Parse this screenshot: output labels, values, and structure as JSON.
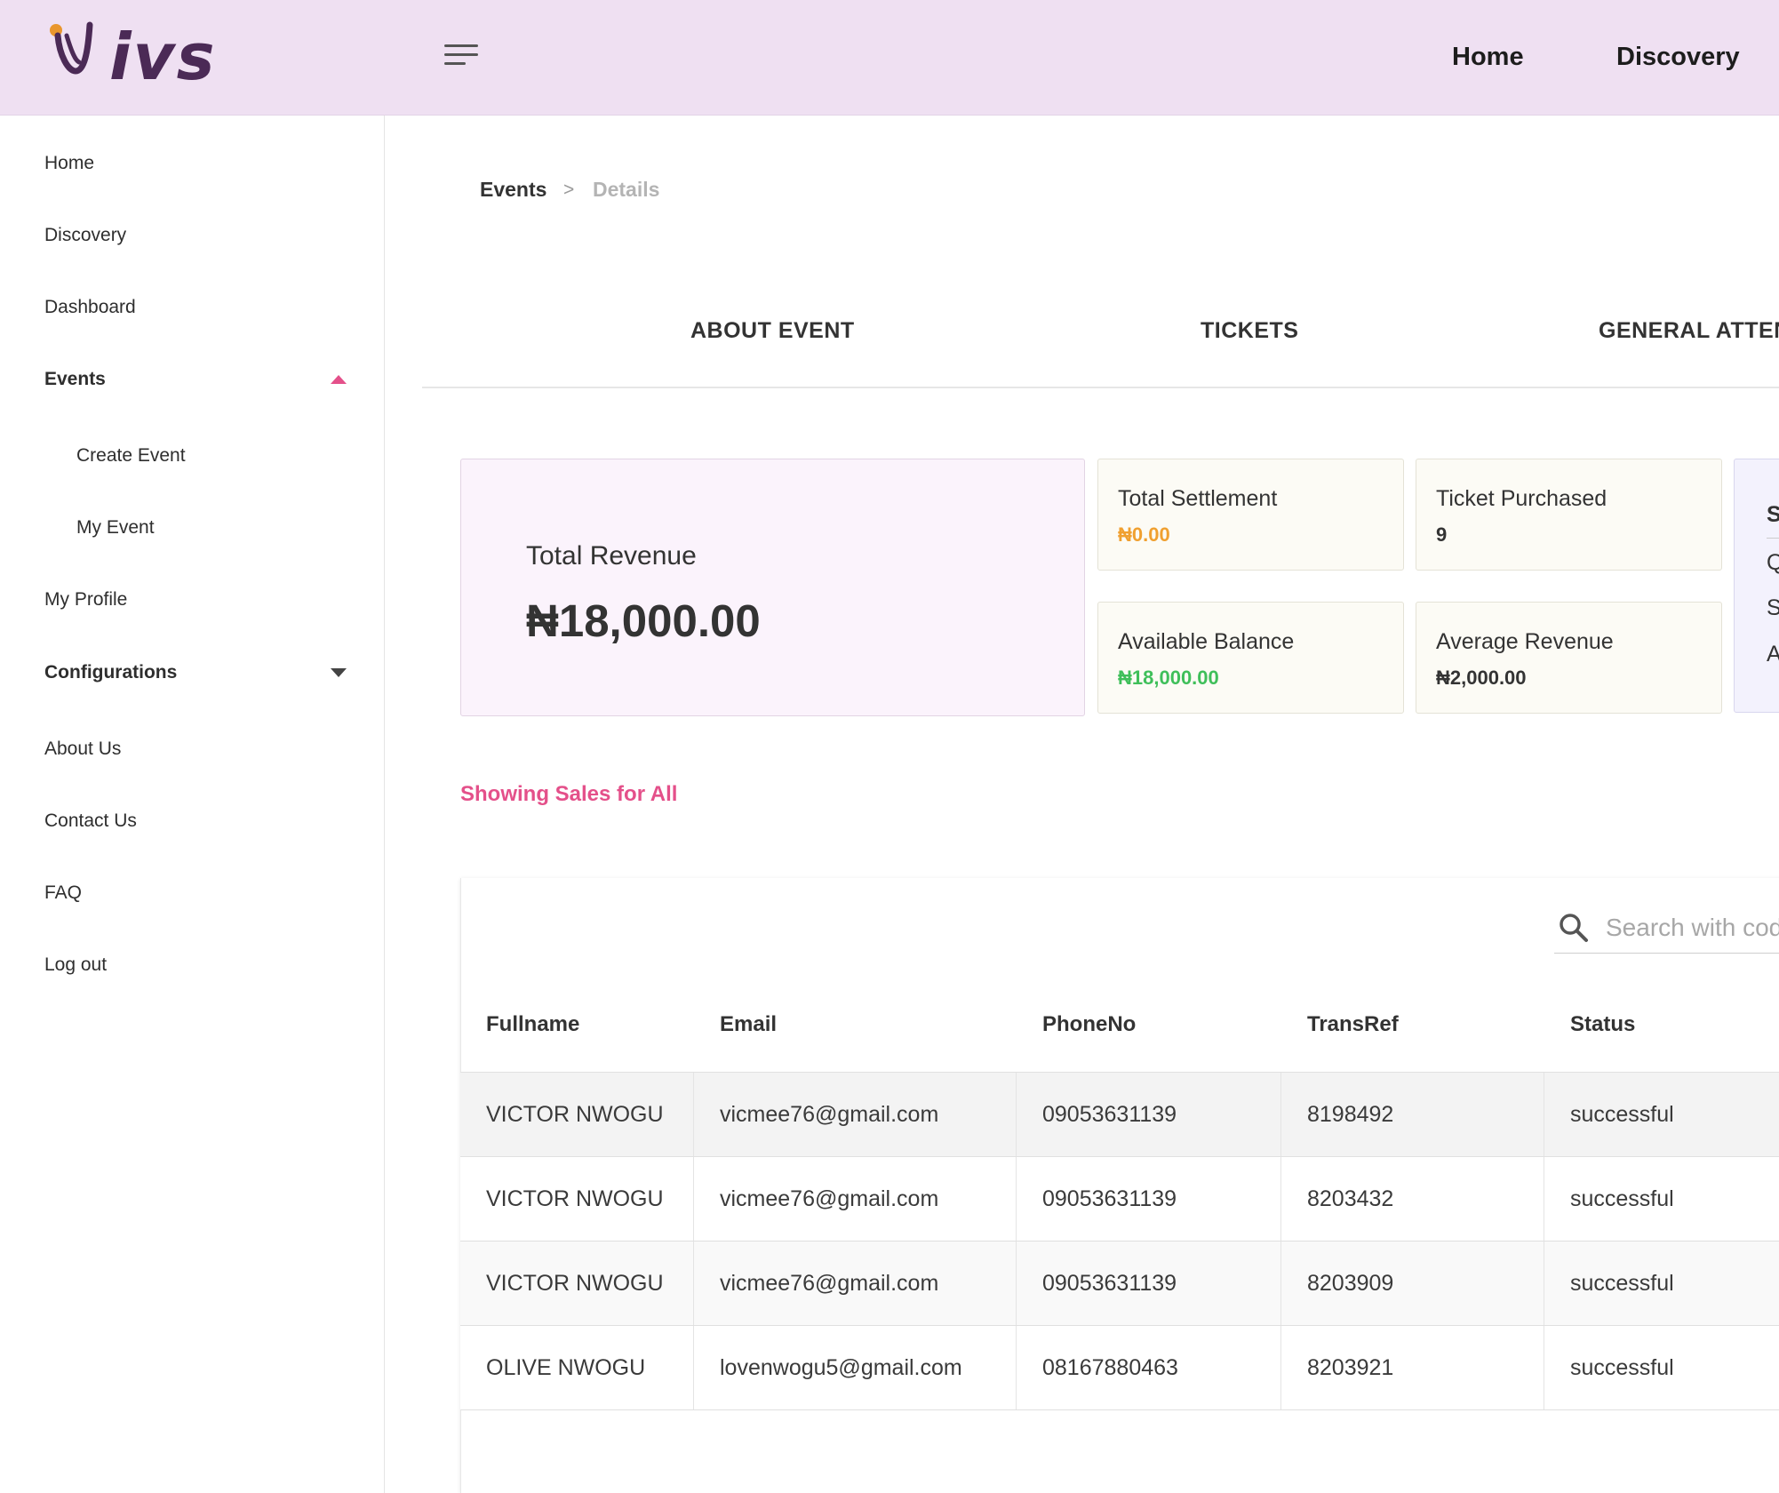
{
  "header": {
    "logo_text": "ivs",
    "nav": [
      "Home",
      "Discovery"
    ]
  },
  "sidebar": {
    "items": [
      {
        "label": "Home"
      },
      {
        "label": "Discovery"
      },
      {
        "label": "Dashboard"
      },
      {
        "label": "Events",
        "expanded": true
      },
      {
        "label": "Create Event"
      },
      {
        "label": "My Event"
      },
      {
        "label": "My Profile"
      },
      {
        "label": "Configurations",
        "expanded": false
      },
      {
        "label": "About Us"
      },
      {
        "label": "Contact Us"
      },
      {
        "label": "FAQ"
      },
      {
        "label": "Log out"
      }
    ]
  },
  "breadcrumb": {
    "root": "Events",
    "separator": ">",
    "current": "Details"
  },
  "tabs": [
    "ABOUT EVENT",
    "TICKETS",
    "GENERAL ATTEN"
  ],
  "stats": {
    "total_revenue": {
      "label": "Total Revenue",
      "value": "₦18,000.00"
    },
    "total_settlement": {
      "label": "Total Settlement",
      "value": "₦0.00",
      "color": "#f0a030"
    },
    "ticket_purchased": {
      "label": "Ticket Purchased",
      "value": "9"
    },
    "available_balance": {
      "label": "Available Balance",
      "value": "₦18,000.00",
      "color": "#3fbf5a"
    },
    "average_revenue": {
      "label": "Average Revenue",
      "value": "₦2,000.00"
    },
    "partial_card": [
      "S",
      "Q",
      "S",
      "A"
    ]
  },
  "sales_heading": "Showing Sales for All",
  "search": {
    "placeholder": "Search with cod"
  },
  "table": {
    "columns": [
      "Fullname",
      "Email",
      "PhoneNo",
      "TransRef",
      "Status"
    ],
    "rows": [
      [
        "VICTOR NWOGU",
        "vicmee76@gmail.com",
        "09053631139",
        "8198492",
        "successful"
      ],
      [
        "VICTOR NWOGU",
        "vicmee76@gmail.com",
        "09053631139",
        "8203432",
        "successful"
      ],
      [
        "VICTOR NWOGU",
        "vicmee76@gmail.com",
        "09053631139",
        "8203909",
        "successful"
      ],
      [
        "OLIVE NWOGU",
        "lovenwogu5@gmail.com",
        "08167880463",
        "8203921",
        "successful"
      ]
    ]
  },
  "colors": {
    "header_bg": "#efe0f2",
    "accent_pink": "#e4508a",
    "brand_purple": "#4b2a56",
    "logo_orange": "#e9962d"
  }
}
